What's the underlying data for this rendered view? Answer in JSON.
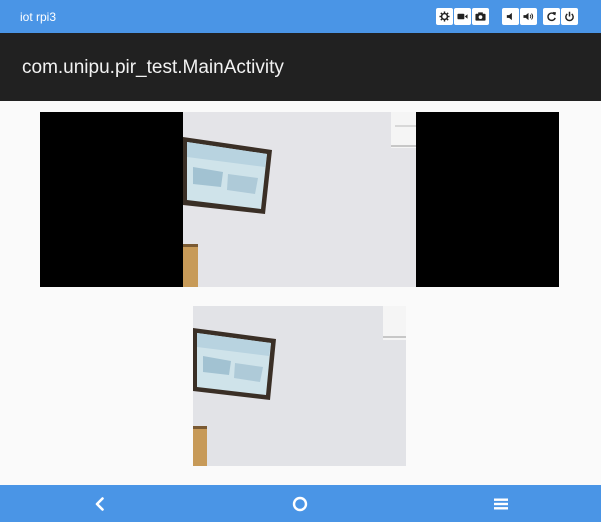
{
  "device": {
    "name": "iot rpi3"
  },
  "toolbar": {
    "icons": [
      "gear-icon",
      "video-camera-icon",
      "camera-icon",
      "volume-down-icon",
      "volume-up-icon",
      "rotate-icon",
      "power-icon"
    ]
  },
  "app": {
    "title": "com.unipu.pir_test.MainActivity"
  },
  "nav": {
    "icons": [
      "back-icon",
      "home-icon",
      "menu-icon"
    ]
  },
  "colors": {
    "accent": "#4a95e6",
    "appbar": "#212121",
    "background": "#fafafa"
  }
}
